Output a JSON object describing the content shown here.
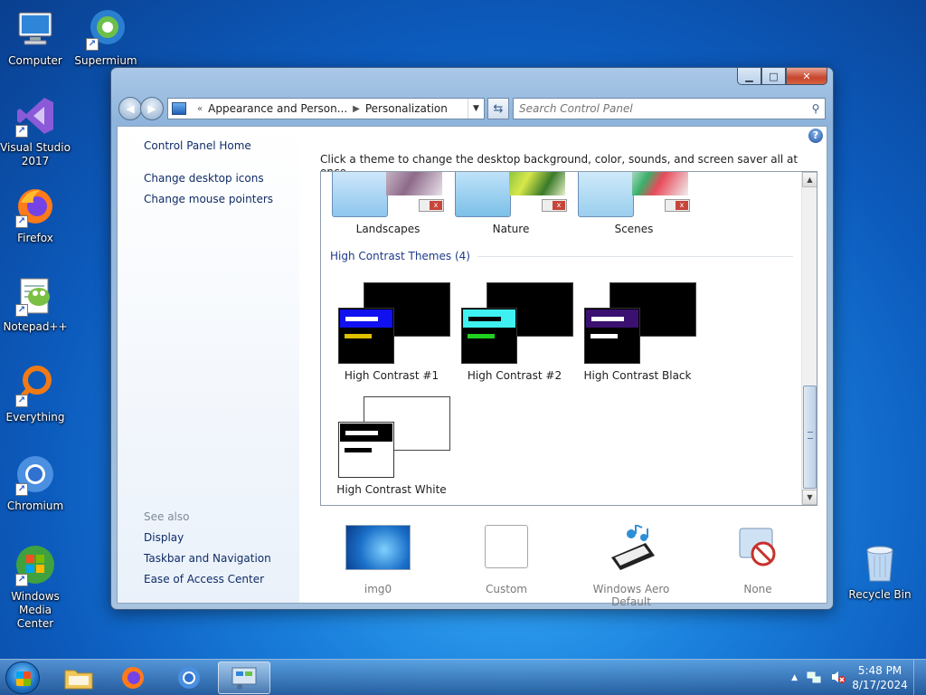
{
  "desktop": {
    "icons": [
      {
        "label": "Computer"
      },
      {
        "label": "Supermium"
      },
      {
        "label": "Visual Studio 2017"
      },
      {
        "label": "Firefox"
      },
      {
        "label": "Notepad++"
      },
      {
        "label": "Everything"
      },
      {
        "label": "Chromium"
      },
      {
        "label": "Windows Media Center"
      }
    ],
    "recycle_bin": "Recycle Bin"
  },
  "window": {
    "address": {
      "crumbs": [
        "Appearance and Person...",
        "Personalization"
      ],
      "chevrons": "«"
    },
    "search_placeholder": "Search Control Panel",
    "left_pane": {
      "home": "Control Panel Home",
      "links": [
        "Change desktop icons",
        "Change mouse pointers"
      ],
      "see_also_label": "See also",
      "see_also": [
        "Display",
        "Taskbar and Navigation",
        "Ease of Access Center"
      ]
    },
    "intro": "Click a theme to change the desktop background, color, sounds, and screen saver all at once.",
    "themes_top": [
      "Landscapes",
      "Nature",
      "Scenes"
    ],
    "high_contrast_header": "High Contrast Themes (4)",
    "high_contrast": [
      {
        "name": "High Contrast #1",
        "back": "#000000",
        "title": "#1010f0",
        "bar1": "#ffffff",
        "bar2": "#e0c000",
        "body": "#000000"
      },
      {
        "name": "High Contrast #2",
        "back": "#000000",
        "title": "#3ff0f0",
        "bar1": "#000000",
        "bar2": "#20d020",
        "body": "#000000"
      },
      {
        "name": "High Contrast Black",
        "back": "#000000",
        "title": "#3a1070",
        "bar1": "#ffffff",
        "bar2": "#ffffff",
        "body": "#000000"
      },
      {
        "name": "High Contrast White",
        "back": "#ffffff",
        "title": "#000000",
        "bar1": "#ffffff",
        "bar2": "#000000",
        "body": "#ffffff"
      }
    ],
    "bottom": [
      {
        "label": "img0"
      },
      {
        "label": "Custom"
      },
      {
        "label": "Windows Aero Default"
      },
      {
        "label": "None"
      }
    ]
  },
  "taskbar": {
    "time": "5:48 PM",
    "date": "8/17/2024"
  }
}
